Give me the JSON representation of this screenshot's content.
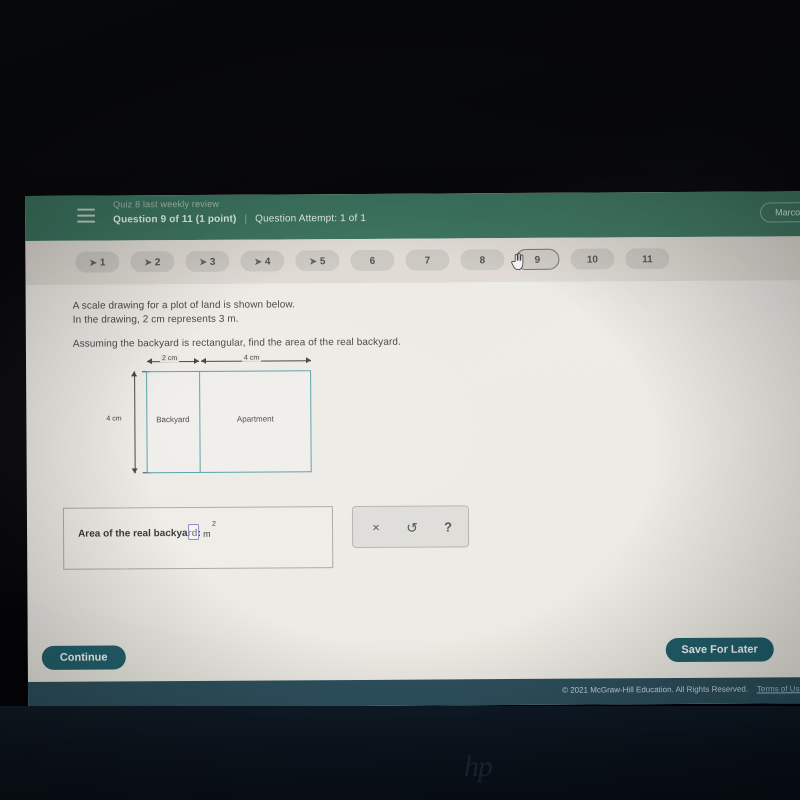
{
  "header": {
    "menu_icon": "hamburger-icon",
    "quiz_title": "Quiz 8 last weekly review",
    "question_progress": "Question 9 of 11 (1 point)",
    "separator": "|",
    "attempt": "Question Attempt: 1 of 1",
    "user_chip": "Marco",
    "bg_color": "#36705a"
  },
  "question_nav": {
    "pills": [
      {
        "label": "1",
        "answered": true,
        "current": false,
        "tick": "➤"
      },
      {
        "label": "2",
        "answered": true,
        "current": false,
        "tick": "➤"
      },
      {
        "label": "3",
        "answered": true,
        "current": false,
        "tick": "➤"
      },
      {
        "label": "4",
        "answered": true,
        "current": false,
        "tick": "➤"
      },
      {
        "label": "5",
        "answered": true,
        "current": false,
        "tick": "➤"
      },
      {
        "label": "6",
        "answered": false,
        "current": false,
        "tick": ""
      },
      {
        "label": "7",
        "answered": false,
        "current": false,
        "tick": ""
      },
      {
        "label": "8",
        "answered": false,
        "current": false,
        "tick": ""
      },
      {
        "label": "9",
        "answered": false,
        "current": true,
        "tick": ""
      },
      {
        "label": "10",
        "answered": false,
        "current": false,
        "tick": ""
      },
      {
        "label": "11",
        "answered": false,
        "current": false,
        "tick": ""
      }
    ]
  },
  "question": {
    "line1": "A scale drawing for a plot of land is shown below.",
    "line2": "In the drawing, 2 cm represents 3 m.",
    "line3": "Assuming the backyard is rectangular, find the area of the real backyard."
  },
  "diagram": {
    "backyard_label": "Backyard",
    "apartment_label": "Apartment",
    "backyard_width": "2 cm",
    "apartment_width": "4 cm",
    "height": "4 cm",
    "stroke_color": "#4f9aa6"
  },
  "answer": {
    "label": "Area of the real backyard:",
    "value": "",
    "placeholder": "",
    "unit": "m",
    "exponent": "2",
    "input_border_color": "#8b84c9"
  },
  "tools": {
    "clear_label": "×",
    "undo_label": "↺",
    "help_label": "?"
  },
  "footer": {
    "continue_label": "Continue",
    "save_label": "Save For Later",
    "copyright": "© 2021 McGraw-Hill Education. All Rights Reserved.",
    "terms_label": "Terms of Use",
    "button_color": "#1f5f6b",
    "bar_color": "#2b4f5c"
  },
  "device": {
    "brand_logo": "hp"
  }
}
